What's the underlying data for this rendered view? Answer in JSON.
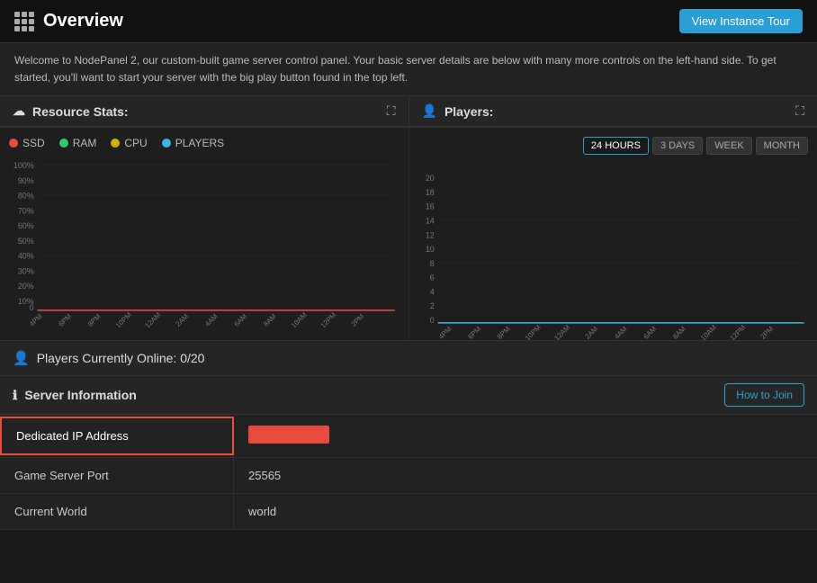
{
  "header": {
    "title": "Overview",
    "tour_button": "View Instance Tour"
  },
  "welcome": {
    "text": "Welcome to NodePanel 2, our custom-built game server control panel. Your basic server details are below with many more controls on the left-hand side. To get started, you'll want to start your server with the big play button found in the top left."
  },
  "resource_stats": {
    "section_title": "Resource Stats:",
    "legend": [
      {
        "label": "SSD",
        "color": "#e74c3c"
      },
      {
        "label": "RAM",
        "color": "#2ecc71"
      },
      {
        "label": "CPU",
        "color": "#c8b400"
      },
      {
        "label": "PLAYERS",
        "color": "#3ab4e0"
      }
    ],
    "time_buttons": [
      "24 HOURS",
      "3 DAYS",
      "WEEK",
      "MONTH"
    ],
    "active_time": "24 HOURS",
    "y_labels_percent": [
      "100%",
      "90%",
      "80%",
      "70%",
      "60%",
      "50%",
      "40%",
      "30%",
      "20%",
      "10%",
      "0"
    ],
    "x_labels": [
      "4PM",
      "6PM",
      "8PM",
      "10PM",
      "12AM",
      "2AM",
      "4AM",
      "6AM",
      "8AM",
      "10AM",
      "12PM",
      "2PM"
    ]
  },
  "players_section": {
    "section_title": "Players:",
    "y_labels": [
      "20",
      "18",
      "16",
      "14",
      "12",
      "10",
      "8",
      "6",
      "4",
      "2",
      "0"
    ],
    "x_labels": [
      "4PM",
      "6PM",
      "8PM",
      "10PM",
      "12AM",
      "2AM",
      "4AM",
      "6AM",
      "8AM",
      "10AM",
      "12PM",
      "2PM"
    ]
  },
  "players_online": {
    "label": "Players Currently Online: 0/20"
  },
  "server_information": {
    "section_title": "Server Information",
    "how_to_join_button": "How to Join",
    "rows": [
      {
        "label": "Dedicated IP Address",
        "value": "REDACTED",
        "highlighted": true
      },
      {
        "label": "Game Server Port",
        "value": "25565"
      },
      {
        "label": "Current World",
        "value": "world"
      }
    ]
  }
}
